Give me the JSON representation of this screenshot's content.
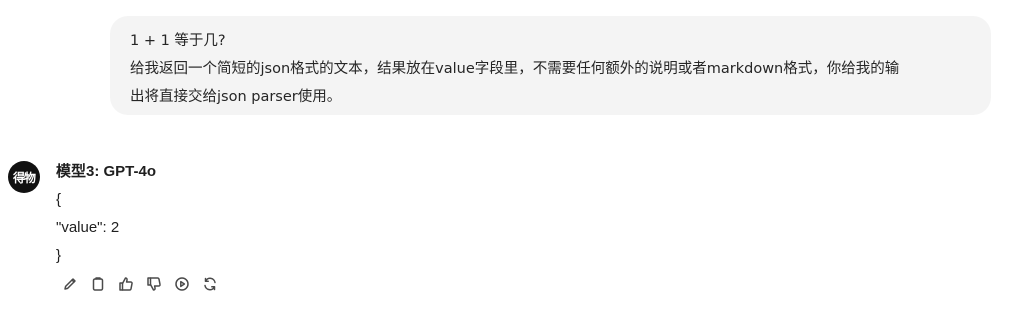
{
  "user_message": {
    "line1": "1 + 1 等于几?",
    "line2": "给我返回一个简短的json格式的文本，结果放在value字段里，不需要任何额外的说明或者markdown格式，你给我的输",
    "line3": "出将直接交给json parser使用。"
  },
  "bot": {
    "avatar_text": "得物",
    "model_name": "模型3: GPT-4o",
    "response_lines": [
      "{",
      "\"value\": 2",
      "}"
    ]
  },
  "actions": [
    "pencil-icon",
    "clipboard-icon",
    "thumbs-up-icon",
    "thumbs-down-icon",
    "play-icon",
    "refresh-icon"
  ]
}
